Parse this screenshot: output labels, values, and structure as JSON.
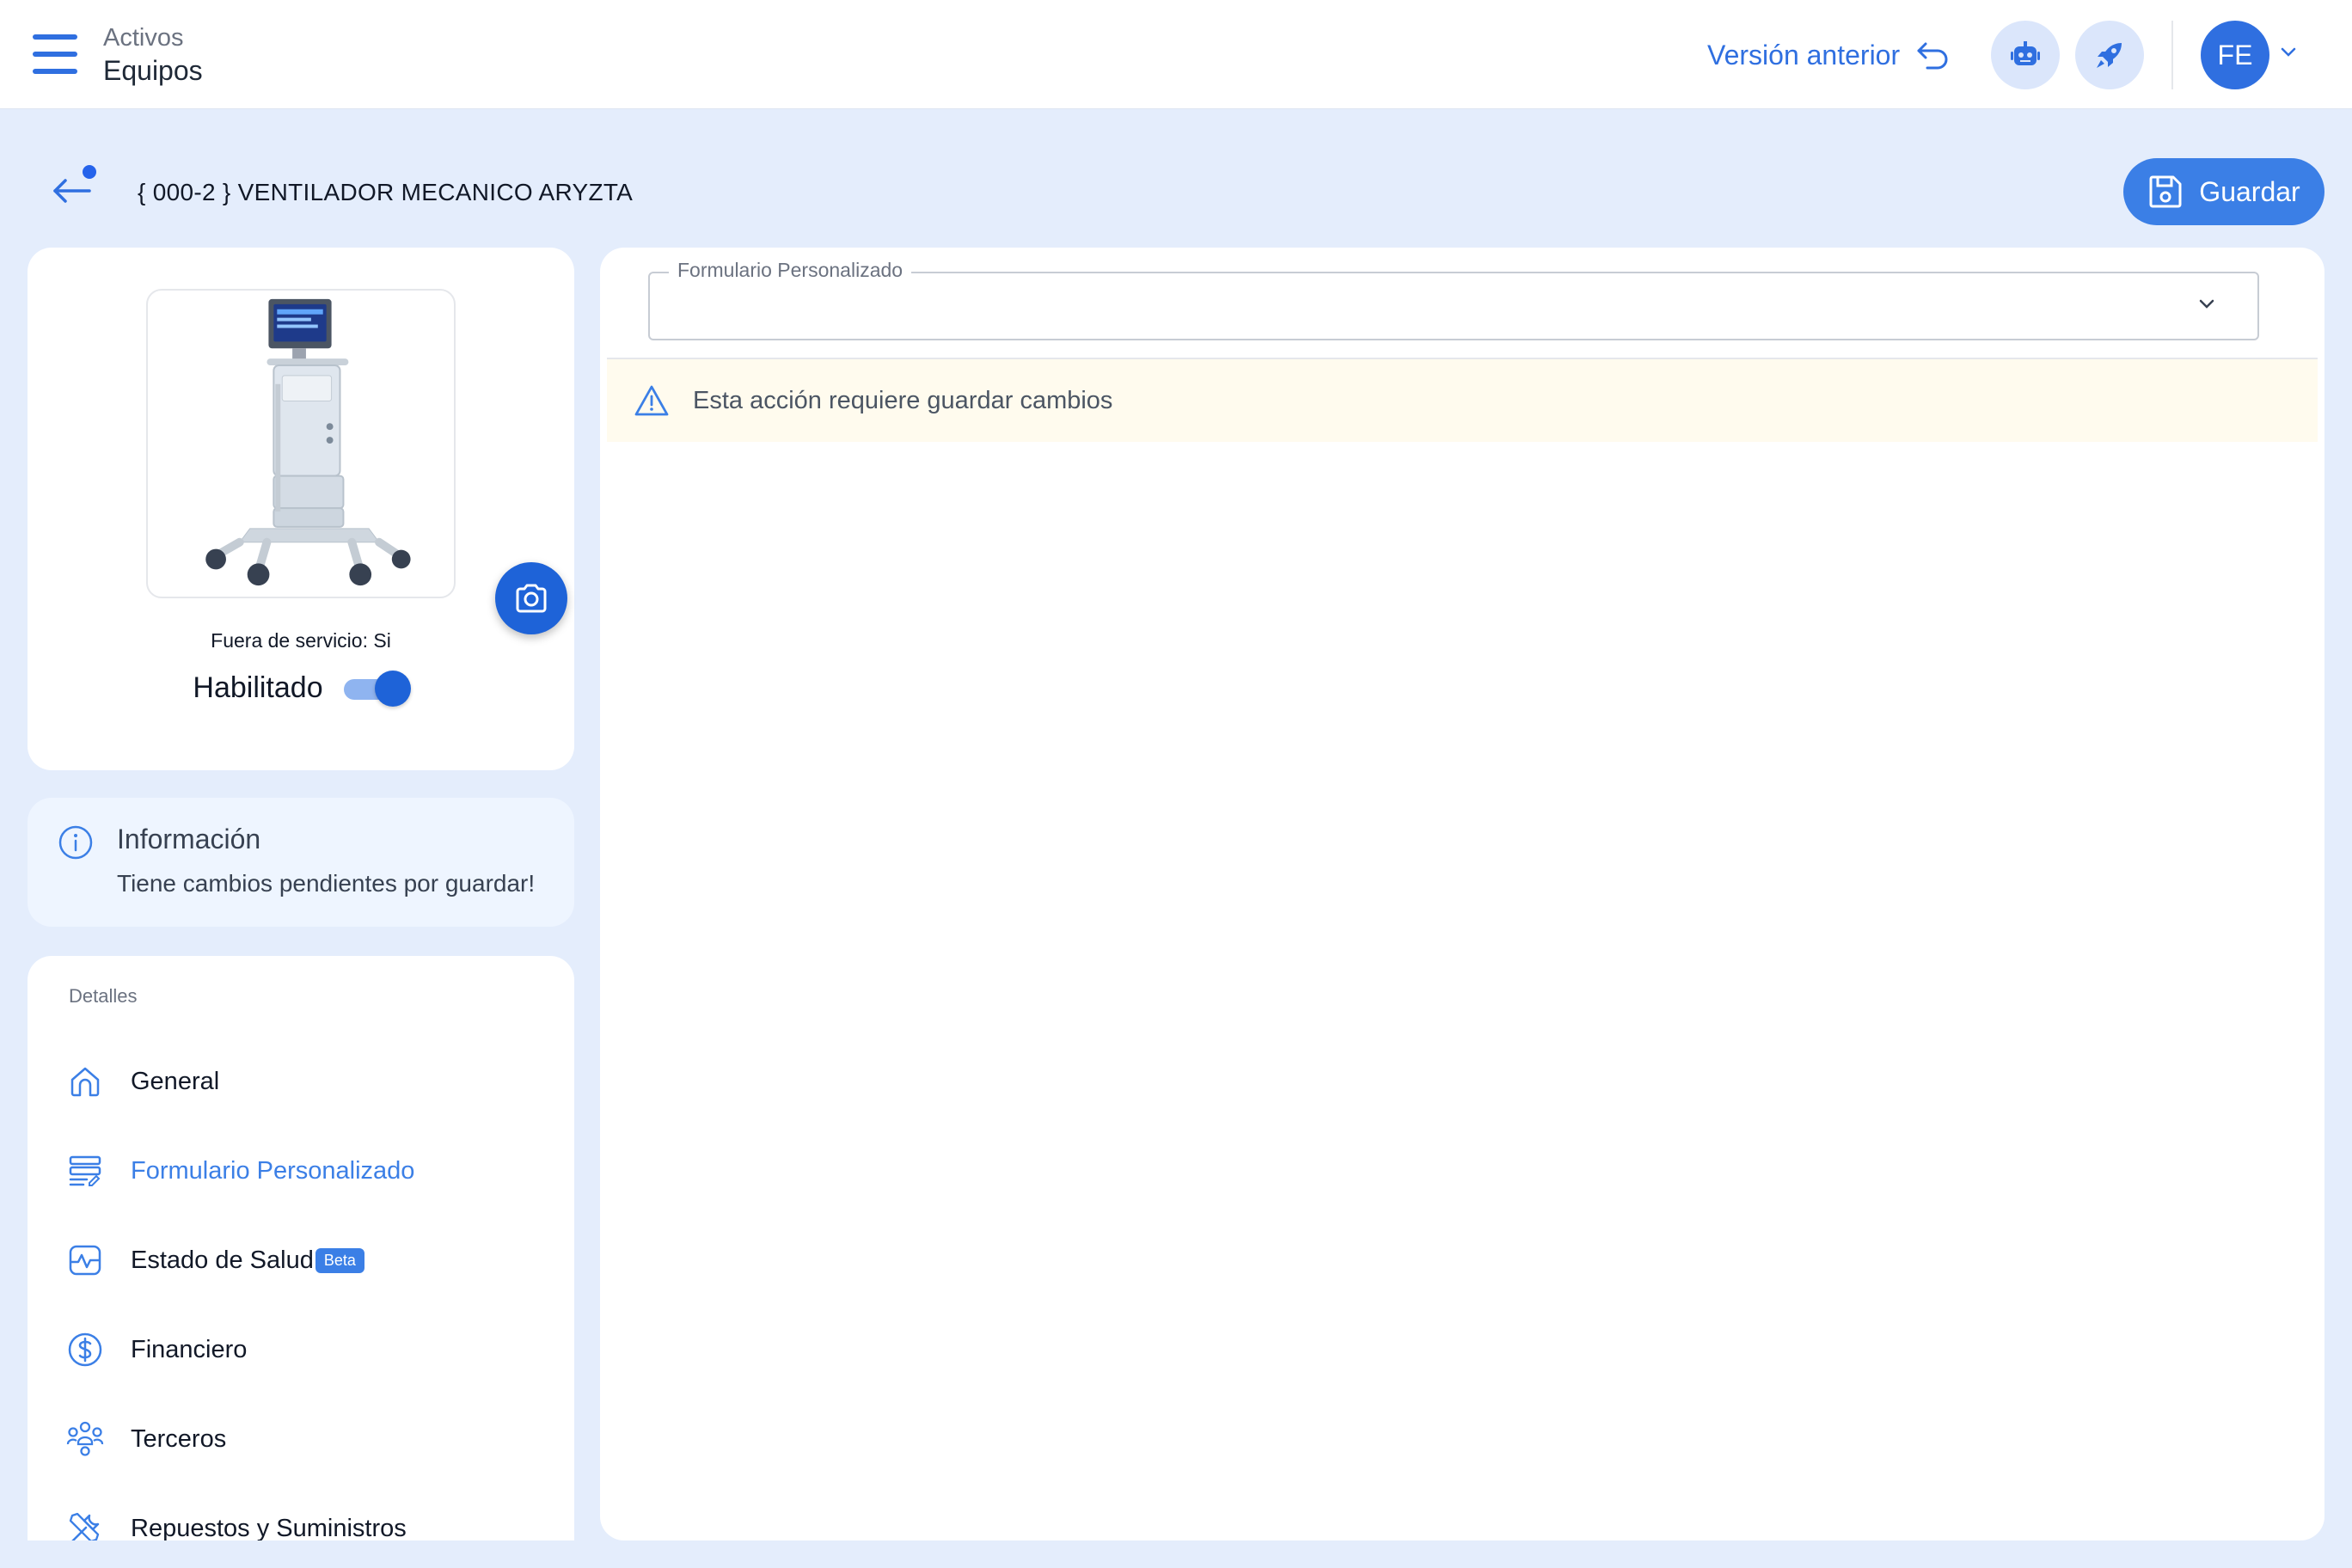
{
  "header": {
    "section": "Activos",
    "page": "Equipos",
    "previous_version_label": "Versión anterior",
    "avatar_initials": "FE"
  },
  "asset": {
    "title": "{ 000-2 } VENTILADOR MECANICO ARYZTA",
    "save_label": "Guardar",
    "out_of_service": "Fuera de servicio: Si",
    "enabled_label": "Habilitado",
    "enabled": true
  },
  "info": {
    "title": "Información",
    "message": "Tiene cambios pendientes por guardar!"
  },
  "details": {
    "label": "Detalles",
    "items": [
      {
        "label": "General",
        "icon": "home-icon"
      },
      {
        "label": "Formulario Personalizado",
        "icon": "form-icon",
        "active": true
      },
      {
        "label": "Estado de Salud",
        "icon": "health-icon",
        "badge": "Beta"
      },
      {
        "label": "Financiero",
        "icon": "dollar-icon"
      },
      {
        "label": "Terceros",
        "icon": "people-icon"
      },
      {
        "label": "Repuestos y Suministros",
        "icon": "tools-icon"
      }
    ]
  },
  "form": {
    "select_label": "Formulario Personalizado",
    "warning": "Esta acción requiere guardar cambios"
  },
  "colors": {
    "accent": "#3b7fe6",
    "background": "#e4edfc",
    "warning_bg": "#fffbee"
  }
}
